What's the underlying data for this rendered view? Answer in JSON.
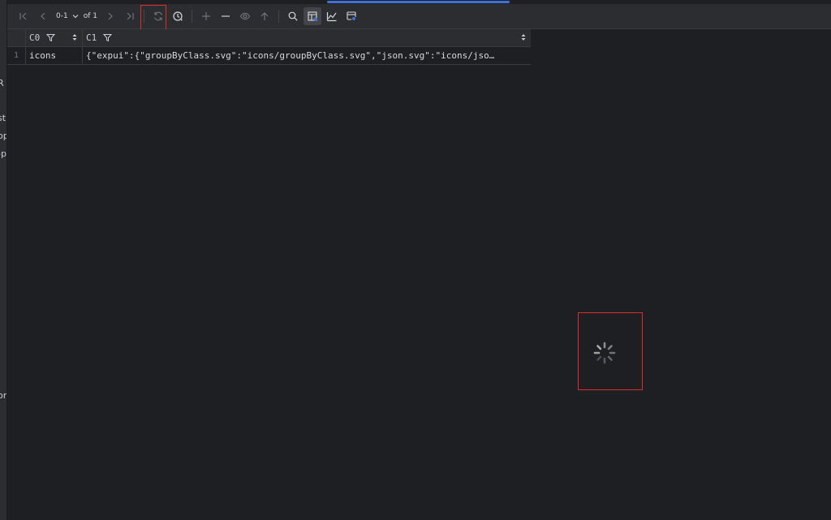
{
  "left_strip": {
    "fragments": [
      "R",
      "st",
      "op",
      "-p",
      "or"
    ]
  },
  "toolbar": {
    "page_range": "0-1",
    "page_total": "of 1",
    "icons": {
      "first_page": "first-page-icon",
      "prev_page": "previous-page-icon",
      "next_page": "next-page-icon",
      "last_page": "last-page-icon",
      "reload": "reload-icon",
      "history": "history-icon",
      "add_row": "add-row-icon",
      "delete_row": "delete-row-icon",
      "preview": "preview-icon",
      "submit": "submit-icon",
      "search": "search-icon",
      "view_mode": "view-mode-icon",
      "chart": "chart-icon",
      "settings": "table-settings-icon"
    }
  },
  "grid": {
    "columns": [
      "C0",
      "C1"
    ],
    "rows": [
      {
        "num": "1",
        "c0": "icons",
        "c1": "{\"expui\":{\"groupByClass.svg\":\"icons/groupByClass.svg\",\"json.svg\":\"icons/jso…"
      }
    ]
  },
  "colors": {
    "background": "#1e1f22",
    "toolbar": "#2b2d30",
    "highlight": "#e02b2b",
    "accent": "#3f72d6"
  }
}
